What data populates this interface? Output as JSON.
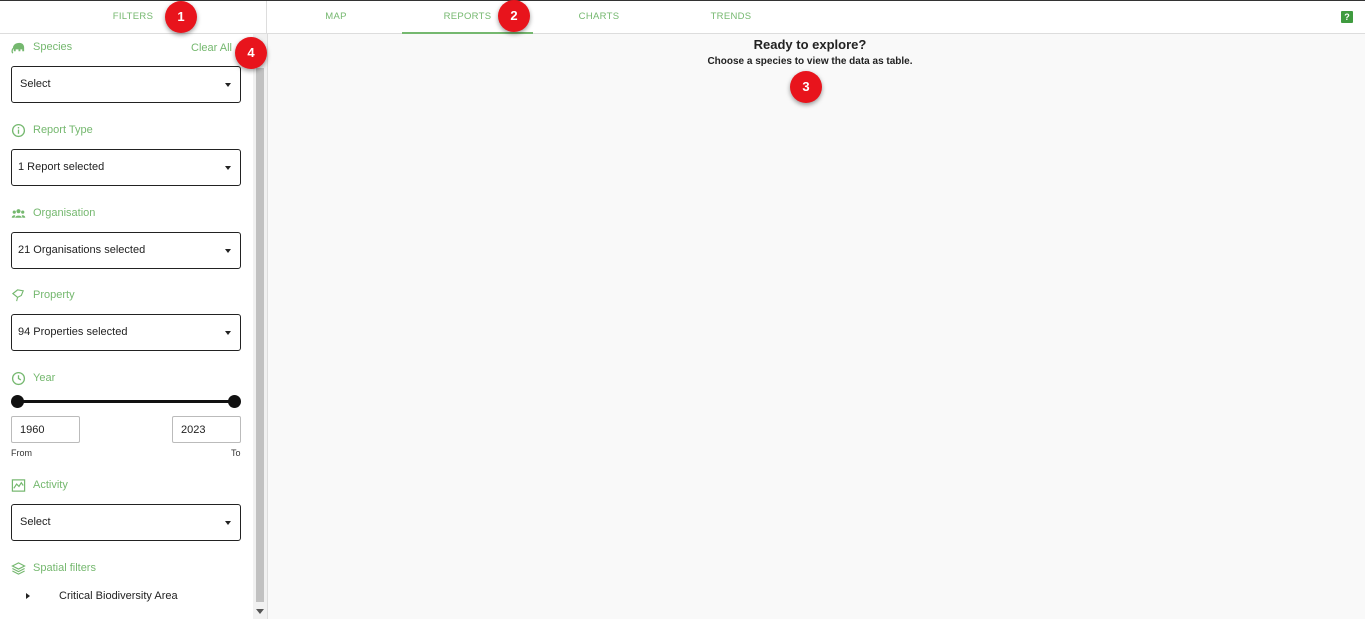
{
  "topbar": {
    "filters_label": "FILTERS",
    "tabs": [
      {
        "label": "MAP",
        "active": false
      },
      {
        "label": "REPORTS",
        "active": true
      },
      {
        "label": "CHARTS",
        "active": false
      },
      {
        "label": "TRENDS",
        "active": false
      }
    ],
    "help_label": "?"
  },
  "sidebar": {
    "clear_all": "Clear All",
    "species": {
      "label": "Species",
      "value": "Select"
    },
    "report_type": {
      "label": "Report Type",
      "value": "1 Report selected"
    },
    "organisation": {
      "label": "Organisation",
      "value": "21 Organisations selected"
    },
    "property": {
      "label": "Property",
      "value": "94 Properties selected"
    },
    "year": {
      "label": "Year",
      "from": "1960",
      "to": "2023",
      "from_label": "From",
      "to_label": "To"
    },
    "activity": {
      "label": "Activity",
      "value": "Select"
    },
    "spatial": {
      "label": "Spatial filters",
      "items": [
        "Critical Biodiversity Area"
      ]
    }
  },
  "main": {
    "title": "Ready to explore?",
    "subtitle": "Choose a species to view the data as table."
  },
  "annotations": [
    "1",
    "2",
    "3",
    "4"
  ],
  "colors": {
    "accent": "#75b86f",
    "badge": "#e8141c"
  }
}
